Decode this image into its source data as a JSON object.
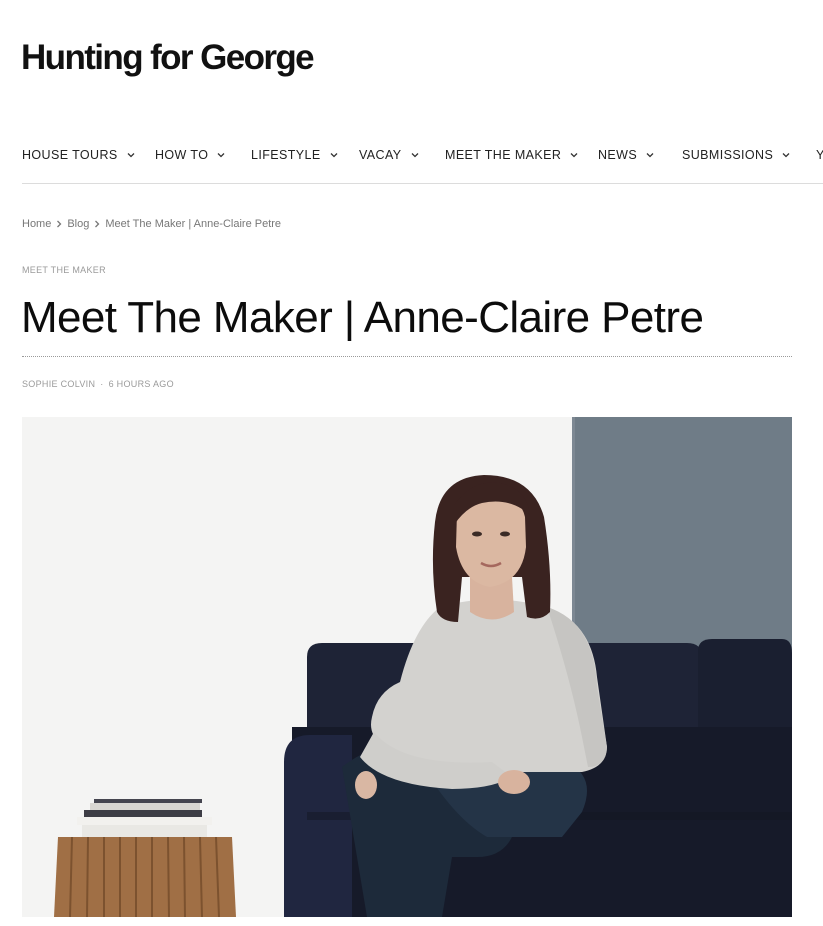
{
  "site": {
    "logo": "Hunting for George"
  },
  "nav": {
    "items": [
      {
        "label": "HOUSE TOURS"
      },
      {
        "label": "HOW TO"
      },
      {
        "label": "LIFESTYLE"
      },
      {
        "label": "VACAY"
      },
      {
        "label": "MEET THE MAKER"
      },
      {
        "label": "NEWS"
      },
      {
        "label": "SUBMISSIONS"
      },
      {
        "label": "Y"
      }
    ],
    "chevron_icon": "chevron-down-icon"
  },
  "breadcrumb": {
    "home": "Home",
    "blog": "Blog",
    "current": "Meet The Maker | Anne-Claire Petre",
    "separator_icon": "chevron-right-icon"
  },
  "article": {
    "category": "MEET THE MAKER",
    "title": "Meet The Maker | Anne-Claire Petre",
    "author": "SOPHIE COLVIN",
    "separator": "·",
    "time": "6 HOURS AGO"
  },
  "colors": {
    "text": "#111111",
    "muted": "#9a9a9a",
    "wall": "#f3f3f3",
    "panel": "#6f7c87",
    "sofa": "#1b2033"
  }
}
